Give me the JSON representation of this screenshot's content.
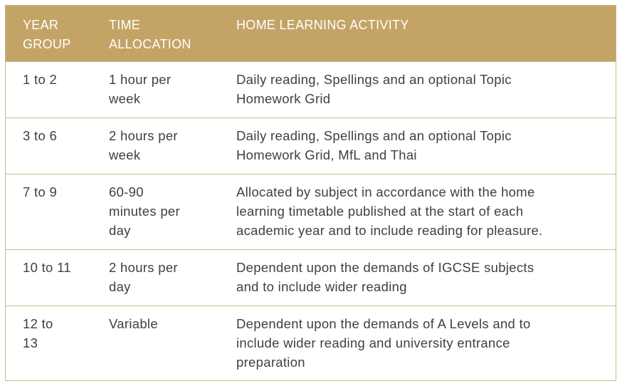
{
  "table": {
    "headers": {
      "year_group": [
        "YEAR",
        "GROUP"
      ],
      "time_allocation": [
        "TIME",
        "ALLOCATION"
      ],
      "activity": [
        "HOME LEARNING ACTIVITY"
      ]
    },
    "rows": [
      {
        "year_group": [
          "1 to 2"
        ],
        "time_allocation": [
          "1 hour per",
          "week"
        ],
        "activity": [
          "Daily reading, Spellings and an optional Topic",
          "Homework Grid"
        ]
      },
      {
        "year_group": [
          "3 to 6"
        ],
        "time_allocation": [
          "2 hours per",
          "week"
        ],
        "activity": [
          "Daily reading, Spellings and an optional Topic",
          "Homework Grid, MfL and Thai"
        ]
      },
      {
        "year_group": [
          "7 to 9"
        ],
        "time_allocation": [
          "60-90",
          "minutes per",
          "day"
        ],
        "activity": [
          "Allocated by subject in accordance with the home",
          "learning timetable published at the start of each",
          "academic year and to include reading for pleasure."
        ]
      },
      {
        "year_group": [
          "10 to 11"
        ],
        "time_allocation": [
          "2 hours per",
          "day"
        ],
        "activity": [
          "Dependent upon the demands of IGCSE subjects",
          "and to include wider reading"
        ]
      },
      {
        "year_group": [
          "12 to",
          "13"
        ],
        "time_allocation": [
          "Variable"
        ],
        "activity": [
          "Dependent upon the demands of A Levels and to",
          "include wider reading and university entrance",
          "preparation"
        ]
      }
    ]
  }
}
